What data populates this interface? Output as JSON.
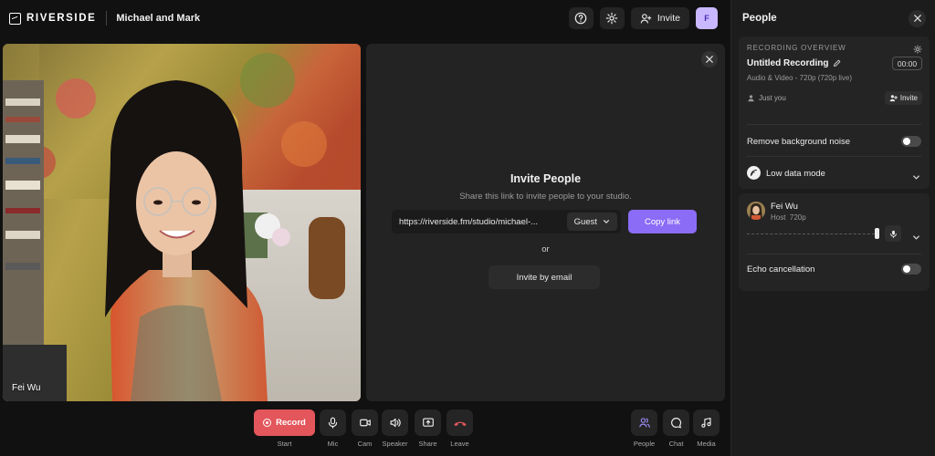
{
  "header": {
    "logo_text": "RIVERSIDE",
    "studio_name": "Michael and Mark",
    "invite_label": "Invite",
    "avatar_initial": "F"
  },
  "video": {
    "participant_label": "Fei Wu"
  },
  "invite_panel": {
    "title": "Invite People",
    "subtitle": "Share this link to invite people to your studio.",
    "link_value": "https://riverside.fm/studio/michael-...",
    "role_select": "Guest",
    "copy_label": "Copy link",
    "or_text": "or",
    "email_label": "Invite by email"
  },
  "controls": {
    "record_label": "Record",
    "start_label": "Start",
    "items": [
      {
        "label": "Mic"
      },
      {
        "label": "Cam"
      },
      {
        "label": "Speaker"
      },
      {
        "label": "Share"
      },
      {
        "label": "Leave"
      },
      {
        "label": "People"
      },
      {
        "label": "Chat"
      },
      {
        "label": "Media"
      }
    ]
  },
  "sidebar": {
    "title": "People",
    "recording_overview": {
      "section_label": "RECORDING OVERVIEW",
      "title": "Untitled Recording",
      "timer": "00:00",
      "meta": "Audio & Video - 720p (720p live)",
      "participants_text": "Just you",
      "invite_label": "Invite",
      "noise_label": "Remove background noise",
      "low_data_label": "Low data mode"
    },
    "participant": {
      "name": "Fei Wu",
      "role": "Host",
      "quality": "720p",
      "echo_label": "Echo cancellation"
    }
  },
  "colors": {
    "accent": "#8b6cf6",
    "record": "#e3565b",
    "leave_icon": "#e3565b",
    "people_icon": "#9b8cf8"
  }
}
